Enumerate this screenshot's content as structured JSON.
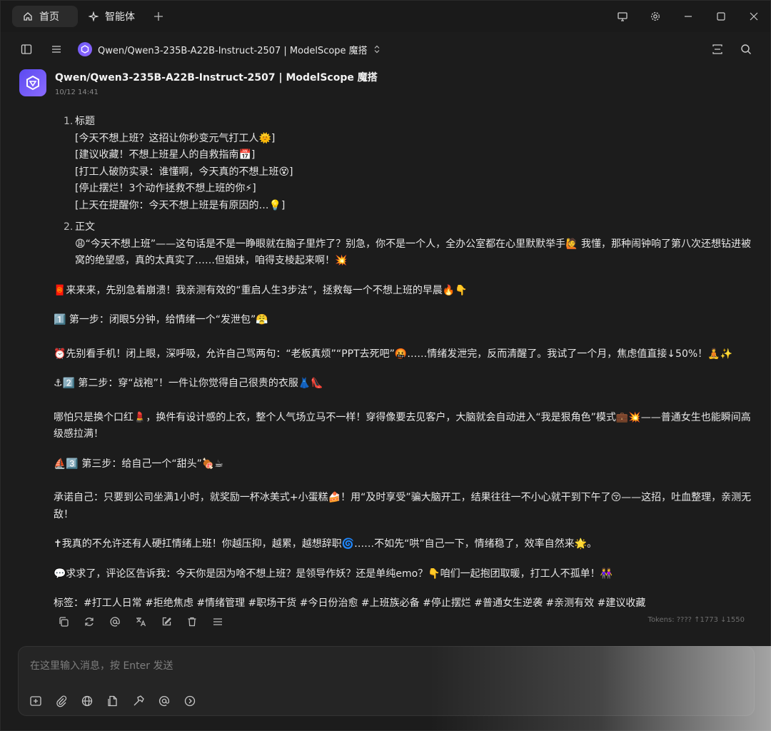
{
  "tabs": [
    {
      "label": "首页"
    },
    {
      "label": "智能体"
    }
  ],
  "toolbar": {
    "model": "Qwen/Qwen3-235B-A22B-Instruct-2507 | ModelScope 魔搭"
  },
  "message": {
    "sender": "Qwen/Qwen3-235B-A22B-Instruct-2507 | ModelScope 魔搭",
    "time": "10/12 14:41",
    "list": [
      {
        "num": "1.",
        "title": "标题",
        "lines": [
          "[今天不想上班？这招让你秒变元气打工人🌞]",
          "[建议收藏！不想上班星人的自救指南📅]",
          "[打工人破防实录：谁懂啊，今天真的不想上班😵]",
          "[停止摆烂！3个动作拯救不想上班的你⚡]",
          "[上天在提醒你：今天不想上班是有原因的…💡]"
        ]
      },
      {
        "num": "2.",
        "title": "正文",
        "lines": [
          "😩“今天不想上班”——这句话是不是一睁眼就在脑子里炸了？别急，你不是一个人，全办公室都在心里默默举手🙋 我懂，那种闹钟响了第八次还想钻进被窝的绝望感，真的太真实了……但姐妹，咱得支棱起来啊！💥"
        ]
      }
    ],
    "paragraphs": [
      "🧧来来来，先别急着崩溃！我亲测有效的“重启人生3步法”，拯救每一个不想上班的早晨🔥👇",
      "1️⃣ 第一步：闭眼5分钟，给情绪一个“发泄包”😤",
      "⏰先别看手机！闭上眼，深呼吸，允许自己骂两句：“老板真烦”“PPT去死吧”🤬……情绪发泄完，反而清醒了。我试了一个月，焦虑值直接↓50%！🧘✨",
      "⚓2️⃣ 第二步：穿“战袍”！一件让你觉得自己很贵的衣服👗👠",
      "哪怕只是换个口红💄，换件有设计感的上衣，整个人气场立马不一样！穿得像要去见客户，大脑就会自动进入“我是狠角色”模式💼💥——普通女生也能瞬间高级感拉满！",
      "⛵3️⃣ 第三步：给自己一个“甜头”🍖☕",
      "承诺自己：只要到公司坐满1小时，就奖励一杯冰美式+小蛋糕🍰！用“及时享受”骗大脑开工，结果往往一不小心就干到下午了😚——这招，吐血整理，亲测无敌！",
      "✝我真的不允许还有人硬扛情绪上班！你越压抑，越累，越想辞职🌀……不如先“哄”自己一下，情绪稳了，效率自然来🌟。",
      "💬求求了，评论区告诉我：今天你是因为啥不想上班？是领导作妖？还是单纯emo？👇咱们一起抱团取暖，打工人不孤单！👭",
      "标签：#打工人日常 #拒绝焦虑 #情绪管理 #职场干货 #今日份治愈 #上班族必备 #停止摆烂 #普通女生逆袭 #亲测有效 #建议收藏"
    ],
    "tokens": "Tokens: ???? ↑1773 ↓1550"
  },
  "input": {
    "placeholder": "在这里输入消息，按 Enter 发送"
  },
  "colors": {
    "accent": "#7b61ff",
    "bg": "#1c1c1c"
  }
}
